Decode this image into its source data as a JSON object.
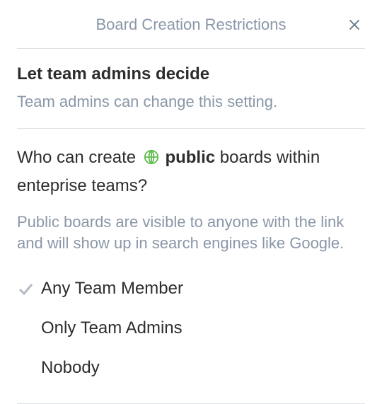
{
  "header": {
    "title": "Board Creation Restrictions"
  },
  "section_admin": {
    "title": "Let team admins decide",
    "desc": "Team admins can change this setting."
  },
  "section_public": {
    "question_pre": "Who can create",
    "question_bold": "public",
    "question_post": "boards within enteprise teams?",
    "desc": "Public boards are visible to anyone with the link and will show up in search engines like Google.",
    "options": [
      {
        "label": "Any Team Member",
        "selected": true
      },
      {
        "label": "Only Team Admins",
        "selected": false
      },
      {
        "label": "Nobody",
        "selected": false
      }
    ]
  }
}
